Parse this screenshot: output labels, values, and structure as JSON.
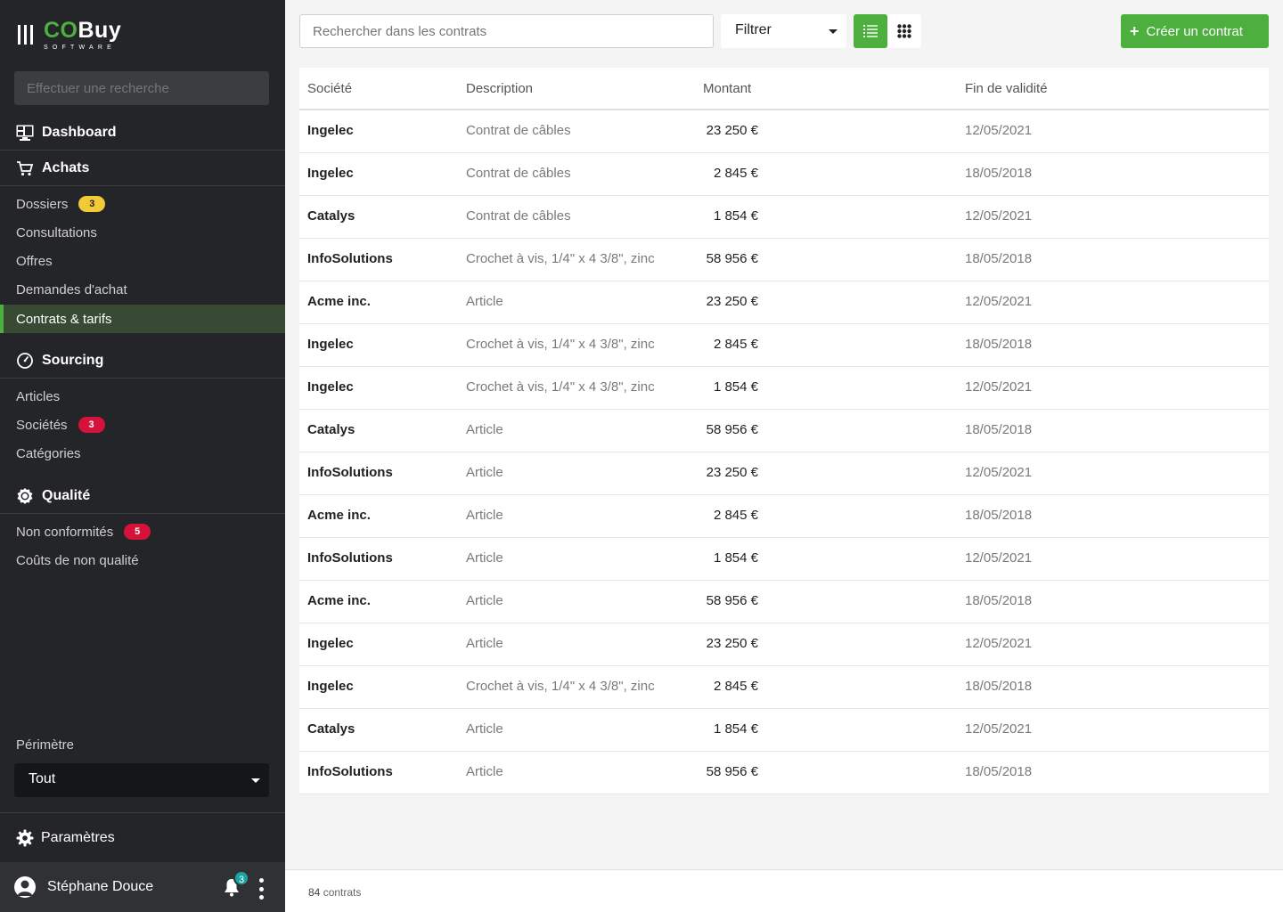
{
  "brand": {
    "part1": "CO",
    "part2": "Buy",
    "sub": "SOFTWARE"
  },
  "sidebar": {
    "search_placeholder": "Effectuer une recherche",
    "sections": {
      "dashboard": "Dashboard",
      "achats": "Achats",
      "sourcing": "Sourcing",
      "qualite": "Qualité"
    },
    "achats_items": [
      {
        "label": "Dossiers",
        "badge": "3"
      },
      {
        "label": "Consultations"
      },
      {
        "label": "Offres"
      },
      {
        "label": "Demandes d'achat"
      },
      {
        "label": "Contrats & tarifs",
        "active": true
      }
    ],
    "sourcing_items": [
      {
        "label": "Articles"
      },
      {
        "label": "Sociétés",
        "badge": "3"
      },
      {
        "label": "Catégories"
      }
    ],
    "qualite_items": [
      {
        "label": "Non conformités",
        "badge": "5"
      },
      {
        "label": "Coûts de non qualité"
      }
    ],
    "perimetre": {
      "label": "Périmètre",
      "value": "Tout"
    },
    "params_label": "Paramètres",
    "user": {
      "name": "Stéphane Douce",
      "notifications": "3"
    }
  },
  "toolbar": {
    "search_placeholder": "Rechercher dans les contrats",
    "filter_label": "Filtrer",
    "create_label": "Créer un contrat"
  },
  "table": {
    "headers": {
      "societe": "Société",
      "description": "Description",
      "montant": "Montant",
      "fin": "Fin de validité"
    },
    "rows": [
      {
        "societe": "Ingelec",
        "description": "Contrat de câbles",
        "montant": "23 250 €",
        "fin": "12/05/2021"
      },
      {
        "societe": "Ingelec",
        "description": "Contrat de câbles",
        "montant": "2 845  €",
        "fin": "18/05/2018"
      },
      {
        "societe": "Catalys",
        "description": "Contrat de câbles",
        "montant": "1 854 €",
        "fin": "12/05/2021"
      },
      {
        "societe": "InfoSolutions",
        "description": "Crochet à vis, 1/4\" x 4 3/8\", zinc",
        "montant": "58 956 €",
        "fin": "18/05/2018"
      },
      {
        "societe": "Acme inc.",
        "description": "Article",
        "montant": "23 250 €",
        "fin": "12/05/2021"
      },
      {
        "societe": "Ingelec",
        "description": "Crochet à vis, 1/4\" x 4 3/8\", zinc",
        "montant": "2 845  €",
        "fin": "18/05/2018"
      },
      {
        "societe": "Ingelec",
        "description": "Crochet à vis, 1/4\" x 4 3/8\", zinc",
        "montant": "1 854 €",
        "fin": "12/05/2021"
      },
      {
        "societe": "Catalys",
        "description": "Article",
        "montant": "58 956 €",
        "fin": "18/05/2018"
      },
      {
        "societe": "InfoSolutions",
        "description": "Article",
        "montant": "23 250 €",
        "fin": "12/05/2021"
      },
      {
        "societe": "Acme inc.",
        "description": "Article",
        "montant": "2 845  €",
        "fin": "18/05/2018"
      },
      {
        "societe": "InfoSolutions",
        "description": "Article",
        "montant": "1 854 €",
        "fin": "12/05/2021"
      },
      {
        "societe": "Acme inc.",
        "description": "Article",
        "montant": "58 956 €",
        "fin": "18/05/2018"
      },
      {
        "societe": "Ingelec",
        "description": "Article",
        "montant": "23 250 €",
        "fin": "12/05/2021"
      },
      {
        "societe": "Ingelec",
        "description": "Crochet à vis, 1/4\" x 4 3/8\", zinc",
        "montant": "2 845  €",
        "fin": "18/05/2018"
      },
      {
        "societe": "Catalys",
        "description": "Article",
        "montant": "1 854 €",
        "fin": "12/05/2021"
      },
      {
        "societe": "InfoSolutions",
        "description": "Article",
        "montant": "58 956 €",
        "fin": "18/05/2018"
      }
    ]
  },
  "footer": {
    "count": "84",
    "count_label": "contrats"
  },
  "colors": {
    "accent": "#4caf3e",
    "sidebar_bg": "#242529",
    "badge_yellow": "#f2c936",
    "badge_red": "#d5133a",
    "notif_teal": "#1aa3a3"
  }
}
